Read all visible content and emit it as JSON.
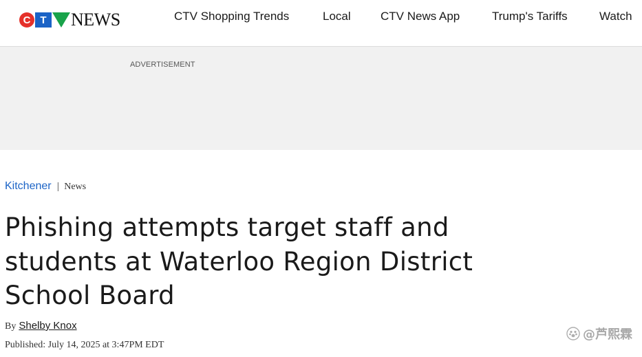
{
  "header": {
    "logo": {
      "letters": [
        "C",
        "T",
        "V"
      ],
      "wordmark": "NEWS"
    },
    "nav": [
      {
        "label": "CTV Shopping Trends"
      },
      {
        "label": "Local"
      },
      {
        "label": "CTV News App"
      },
      {
        "label": "Trump's Tariffs"
      },
      {
        "label": "Watch"
      }
    ]
  },
  "ad": {
    "label": "ADVERTISEMENT"
  },
  "article": {
    "breadcrumb": {
      "section": "Kitchener",
      "separator": "|",
      "type": "News"
    },
    "headline": "Phishing attempts target staff and students at Waterloo Region District School Board",
    "byline": {
      "prefix": "By",
      "author": "Shelby Knox"
    },
    "published": "Published: July 14, 2025 at 3:47PM EDT"
  },
  "watermark": {
    "text": "@芦熙霖",
    "icon": "paw-icon"
  },
  "colors": {
    "ctv_red": "#e5312a",
    "ctv_blue": "#1b63c6",
    "ctv_green": "#19a34a",
    "link_blue": "#1b63c6",
    "ad_background": "#f1f1f1"
  }
}
